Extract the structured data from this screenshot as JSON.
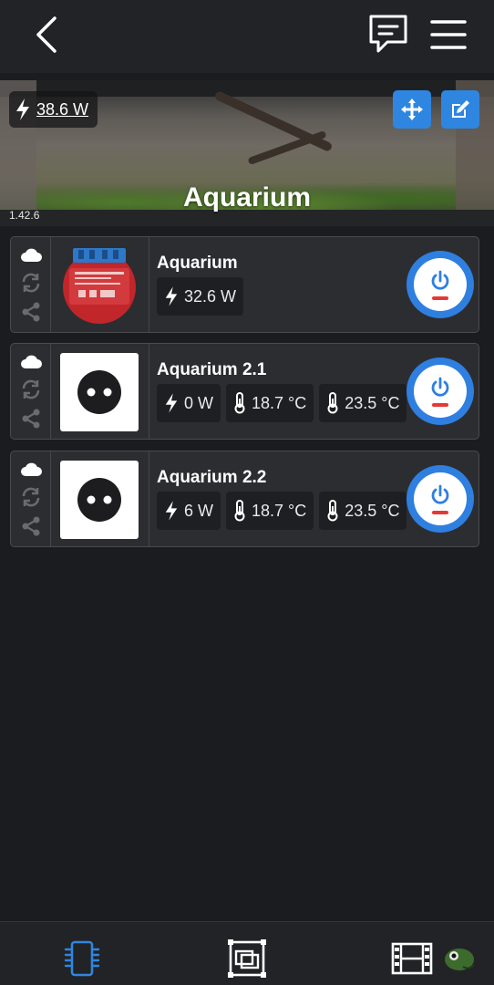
{
  "header": {
    "back_icon": "chevron-left-icon",
    "chat_icon": "chat-bubble-icon",
    "menu_icon": "hamburger-menu-icon"
  },
  "banner": {
    "power_value": "38.6 W",
    "title": "Aquarium",
    "version": "1.42.6"
  },
  "devices": [
    {
      "name": "Aquarium",
      "thumb": "relay-module",
      "stats": [
        {
          "icon": "bolt-icon",
          "value": "32.6 W"
        }
      ],
      "on": false
    },
    {
      "name": "Aquarium 2.1",
      "thumb": "socket-plug",
      "stats": [
        {
          "icon": "bolt-icon",
          "value": "0 W"
        },
        {
          "icon": "thermometer-icon",
          "value": "18.7 °C"
        },
        {
          "icon": "thermometer-icon",
          "value": "23.5 °C"
        }
      ],
      "on": false
    },
    {
      "name": "Aquarium 2.2",
      "thumb": "socket-plug",
      "stats": [
        {
          "icon": "bolt-icon",
          "value": "6 W"
        },
        {
          "icon": "thermometer-icon",
          "value": "18.7 °C"
        },
        {
          "icon": "thermometer-icon",
          "value": "23.5 °C"
        }
      ],
      "on": false
    }
  ],
  "bottom_nav": [
    {
      "icon": "devices-icon",
      "active": true
    },
    {
      "icon": "rooms-icon",
      "active": false
    },
    {
      "icon": "scenes-icon",
      "active": false
    }
  ],
  "colors": {
    "accent": "#2f86e0",
    "off_indicator": "#e53935",
    "background": "#1b1c1f"
  }
}
